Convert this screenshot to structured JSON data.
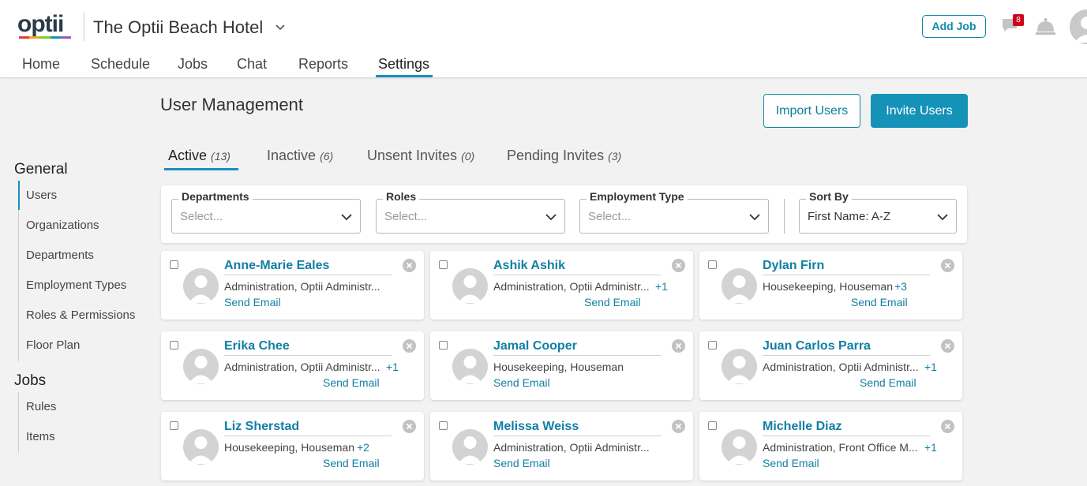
{
  "header": {
    "logo_text": "optii",
    "logo_colors": [
      "#e23b3b",
      "#f5a623",
      "#7ed321",
      "#1a8fbf",
      "#9b59b6"
    ],
    "hotel_name": "The Optii Beach Hotel",
    "add_job_label": "Add Job",
    "notification_count": "8",
    "nav": [
      "Home",
      "Schedule",
      "Jobs",
      "Chat",
      "Reports",
      "Settings"
    ],
    "active_nav": "Settings"
  },
  "sidebar": {
    "general_heading": "General",
    "general_items": [
      "Users",
      "Organizations",
      "Departments",
      "Employment Types",
      "Roles & Permissions",
      "Floor Plan"
    ],
    "jobs_heading": "Jobs",
    "jobs_items": [
      "Rules",
      "Items"
    ],
    "active_item": "Users"
  },
  "main": {
    "title": "User Management",
    "import_label": "Import Users",
    "invite_label": "Invite Users",
    "tabs": [
      {
        "label": "Active",
        "count": "(13)"
      },
      {
        "label": "Inactive",
        "count": "(6)"
      },
      {
        "label": "Unsent Invites",
        "count": "(0)"
      },
      {
        "label": "Pending Invites",
        "count": "(3)"
      }
    ],
    "filters": [
      {
        "label": "Departments",
        "value": "Select..."
      },
      {
        "label": "Roles",
        "value": "Select..."
      },
      {
        "label": "Employment Type",
        "value": "Select..."
      },
      {
        "label": "Sort By",
        "value": "First Name: A-Z"
      }
    ],
    "users": [
      {
        "name": "Anne-Marie Eales",
        "roles": "Administration, Optii Administr...",
        "extra": "",
        "email_label": "Send Email"
      },
      {
        "name": "Ashik Ashik",
        "roles": "Administration, Optii Administr...",
        "extra": "+1",
        "email_label": "Send Email"
      },
      {
        "name": "Dylan Firn",
        "roles": "Housekeeping, Houseman",
        "extra": "+3",
        "email_label": "Send Email"
      },
      {
        "name": "Erika Chee",
        "roles": "Administration, Optii Administr...",
        "extra": "+1",
        "email_label": "Send Email"
      },
      {
        "name": "Jamal Cooper",
        "roles": "Housekeeping, Houseman",
        "extra": "",
        "email_label": "Send Email"
      },
      {
        "name": "Juan Carlos Parra",
        "roles": "Administration, Optii Administr...",
        "extra": "+1",
        "email_label": "Send Email"
      },
      {
        "name": "Liz Sherstad",
        "roles": "Housekeeping, Houseman",
        "extra": "+2",
        "email_label": "Send Email"
      },
      {
        "name": "Melissa Weiss",
        "roles": "Administration, Optii Administr...",
        "extra": "",
        "email_label": "Send Email"
      },
      {
        "name": "Michelle Diaz",
        "roles": "Administration, Front Office M...",
        "extra": "+1",
        "email_label": "Send Email"
      }
    ]
  }
}
